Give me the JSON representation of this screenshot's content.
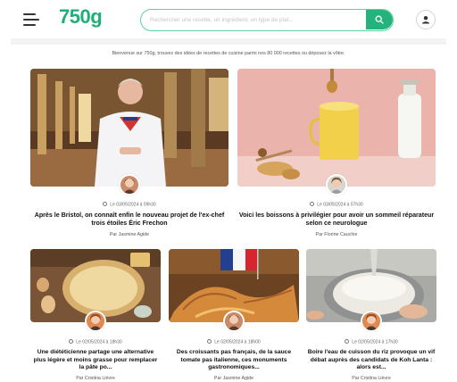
{
  "header": {
    "logo": "750g",
    "search": {
      "placeholder": "Rechercher une recette, un ingrédient, un type de plat...",
      "value": ""
    }
  },
  "intro_text": "Bienvenue sur 750g, trouvez des idées de recettes de cuisine parmi nos 80 000 recettes ou déposez la vôtre.",
  "articles": [
    {
      "date": "Le 03/05/2024 à 09h30",
      "title": "Après le Bristol, on connaît enfin le nouveau projet de l'ex-chef trois étoiles Éric Frechon",
      "author": "Par Jasmine Agide"
    },
    {
      "date": "Le 03/05/2024 à 07h30",
      "title": "Voici les boissons à privilégier pour avoir un sommeil réparateur selon ce neurologue",
      "author": "Par Florine Cauchie"
    },
    {
      "date": "Le 02/05/2024 à 18h30",
      "title": "Une diététicienne partage une alternative plus légère et moins grasse pour remplacer la pâte po...",
      "author": "Par Cristina Lièvre"
    },
    {
      "date": "Le 02/05/2024 à 18h00",
      "title": "Des croissants pas français, de la sauce tomate pas italienne, ces monuments gastronomiques...",
      "author": "Par Jasmine Agide"
    },
    {
      "date": "Le 02/05/2024 à 17h30",
      "title": "Boire l'eau de cuisson du riz provoque un vif débat auprès des candidats de Koh Lanta : alors est...",
      "author": "Par Cristina Lièvre"
    }
  ],
  "icons": {
    "menu": "hamburger-icon",
    "search": "search-icon",
    "user": "user-icon",
    "clock": "clock-icon"
  },
  "colors": {
    "brand": "#1fb07a",
    "search_border": "#5ed1a2",
    "search_button": "#25b27d"
  }
}
